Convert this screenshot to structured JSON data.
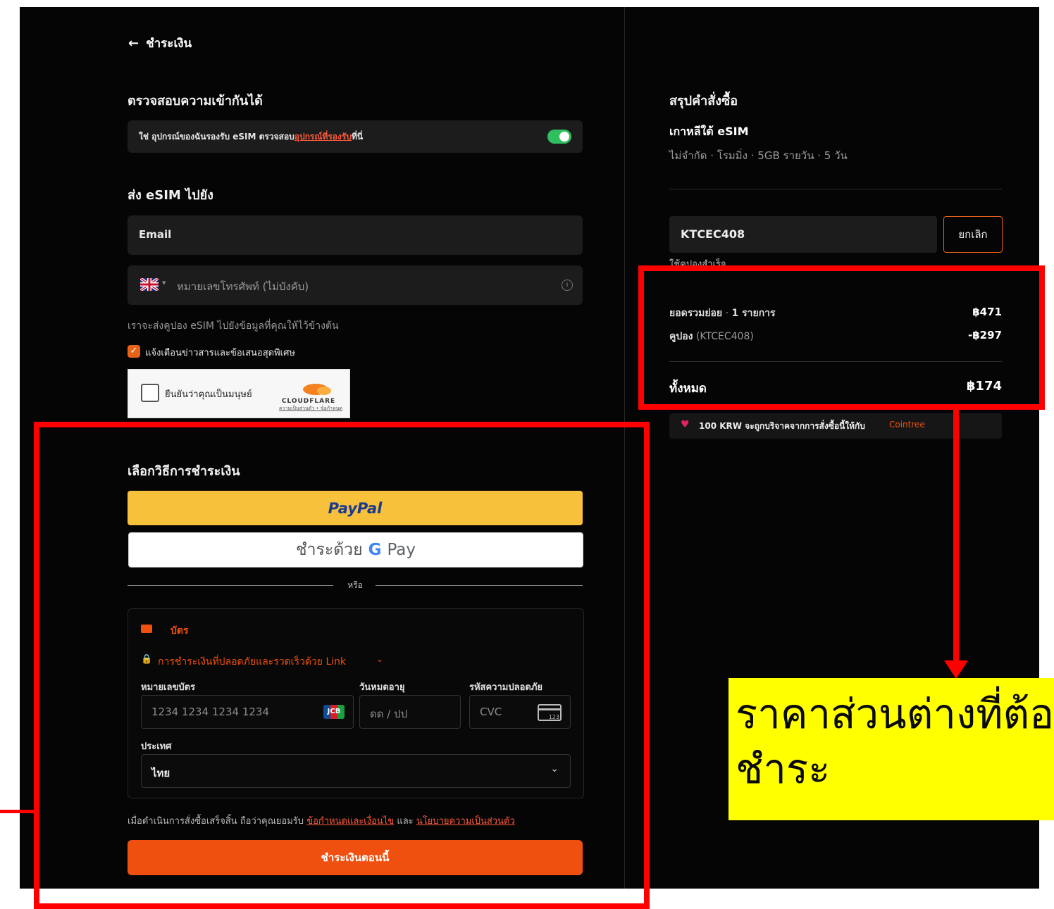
{
  "header": {
    "back_label": "ชำระเงิน"
  },
  "compat": {
    "title": "ตรวจสอบความเข้ากันได้",
    "text": "ใช่ อุปกรณ์ของฉันรองรับ eSIM ตรวจสอบ",
    "link": "อุปกรณ์ที่รองรับ",
    "suffix": "ที่นี่",
    "toggle_on": true
  },
  "send": {
    "title": "ส่ง eSIM ไปยัง",
    "email_placeholder": "Email",
    "phone_placeholder": "หมายเลขโทรศัพท์ (ไม่บังคับ)",
    "note": "เราจะส่งคูปอง eSIM ไปยังข้อมูลที่คุณให้ไว้ข้างต้น",
    "newsletter_label": "แจ้งเตือนข่าวสารและข้อเสนอสุดพิเศษ"
  },
  "captcha": {
    "label": "ยืนยันว่าคุณเป็นมนุษย์",
    "brand": "CLOUDFLARE",
    "links": "ความเป็นส่วนตัว • ข้อกำหนด"
  },
  "payment": {
    "title": "เลือกวิธีการชำระเงิน",
    "paypal_label": "PayPal",
    "gpay_prefix": "ชำระด้วย",
    "gpay_label": "Pay",
    "or_label": "หรือ",
    "card_tab": "บัตร",
    "link_text": "การชำระเงินที่ปลอดภัยและรวดเร็วด้วย Link",
    "card_number_label": "หมายเลขบัตร",
    "card_number_placeholder": "1234 1234 1234 1234",
    "expiry_label": "วันหมดอายุ",
    "expiry_placeholder": "ดด / ปป",
    "cvc_label": "รหัสความปลอดภัย",
    "cvc_placeholder": "CVC",
    "country_label": "ประเทศ",
    "country_value": "ไทย",
    "terms_prefix": "เมื่อดำเนินการสั่งซื้อเสร็จสิ้น ถือว่าคุณยอมรับ",
    "terms_link": "ข้อกำหนดและเงื่อนไข",
    "terms_and": "และ",
    "privacy_link": "นโยบายความเป็นส่วนตัว",
    "pay_now": "ชำระเงินตอนนี้"
  },
  "summary": {
    "title": "สรุปคำสั่งซื้อ",
    "product": "เกาหลีใต้ eSIM",
    "details": "ไม่จำกัด · โรมมิ่ง · 5GB รายวัน · 5 วัน",
    "coupon_code": "KTCEC408",
    "cancel_label": "ยกเลิก",
    "applied_note": "ใช้คูปองสำเร็จ",
    "subtotal_label": "ยอดรวมย่อย",
    "subtotal_count": "1 รายการ",
    "subtotal_value": "฿471",
    "coupon_label": "คูปอง",
    "coupon_ref": "(KTCEC408)",
    "coupon_value": "-฿297",
    "total_label": "ทั้งหมด",
    "total_value": "฿174",
    "donation_text": "100 KRW จะถูกบริจาคจากการสั่งซื้อนี้ให้กับ",
    "donation_org": "Cointree"
  },
  "annotation": {
    "line1": "ราคาส่วนต่างที่ต้อง",
    "line2": "ชำระ"
  },
  "colors": {
    "accent_orange": "#f0500f",
    "paypal_yellow": "#f7c13b",
    "toggle_green": "#2fbf5f",
    "highlight_red": "#ff0000",
    "annotation_yellow": "#ffff00"
  }
}
